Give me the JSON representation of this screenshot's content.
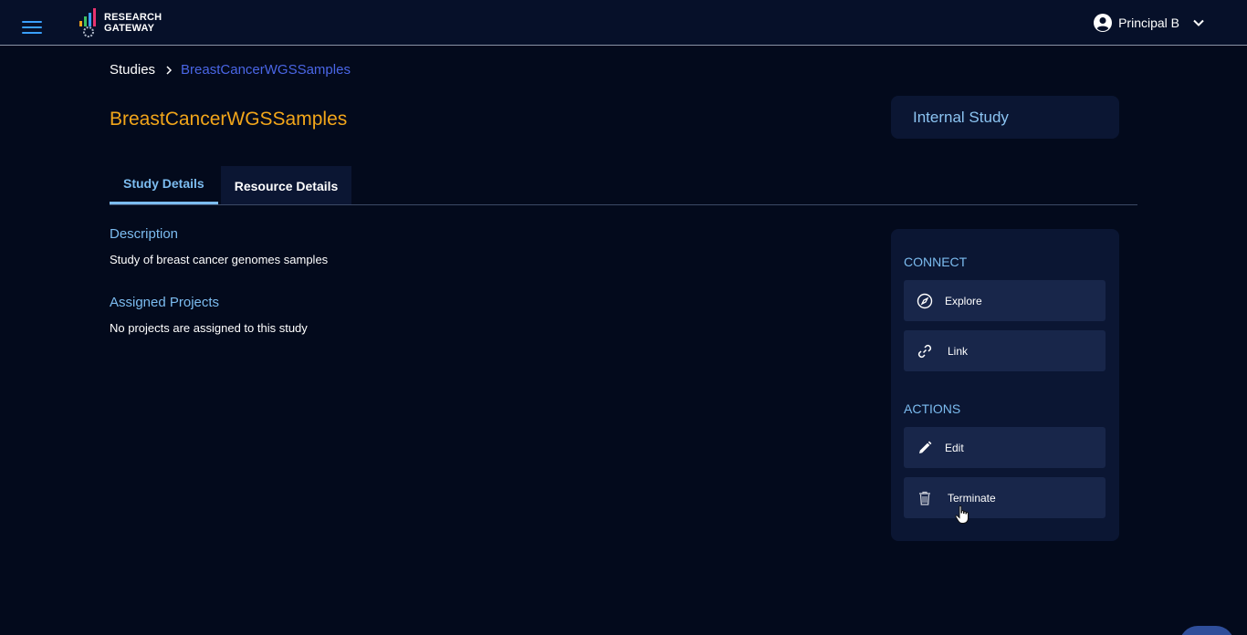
{
  "header": {
    "logo_line1": "RESEARCH",
    "logo_line2": "GATEWAY",
    "user_name": "Principal B"
  },
  "breadcrumb": {
    "root": "Studies",
    "current": "BreastCancerWGSSamples"
  },
  "page": {
    "title": "BreastCancerWGSSamples",
    "study_type": "Internal Study"
  },
  "tabs": [
    {
      "label": "Study Details",
      "active": true
    },
    {
      "label": "Resource Details",
      "active": false
    }
  ],
  "details": {
    "description_heading": "Description",
    "description_text": "Study of breast cancer genomes samples",
    "projects_heading": "Assigned Projects",
    "projects_text": "No projects are assigned to this study"
  },
  "side_panel": {
    "connect_heading": "CONNECT",
    "explore_label": "Explore",
    "link_label": "Link",
    "actions_heading": "ACTIONS",
    "edit_label": "Edit",
    "terminate_label": "Terminate"
  },
  "colors": {
    "background": "#030a1c",
    "header": "#061029",
    "title_accent": "#f2a61a",
    "link_blue": "#4a66e6",
    "heading_blue": "#7cbcf0",
    "panel": "#0b1633",
    "button": "#18264a"
  },
  "icons": {
    "menu": "hamburger-icon",
    "user": "user-circle-icon",
    "dropdown": "chevron-down-icon",
    "explore": "compass-icon",
    "link": "chain-link-icon",
    "edit": "pencil-icon",
    "terminate": "trash-icon"
  }
}
